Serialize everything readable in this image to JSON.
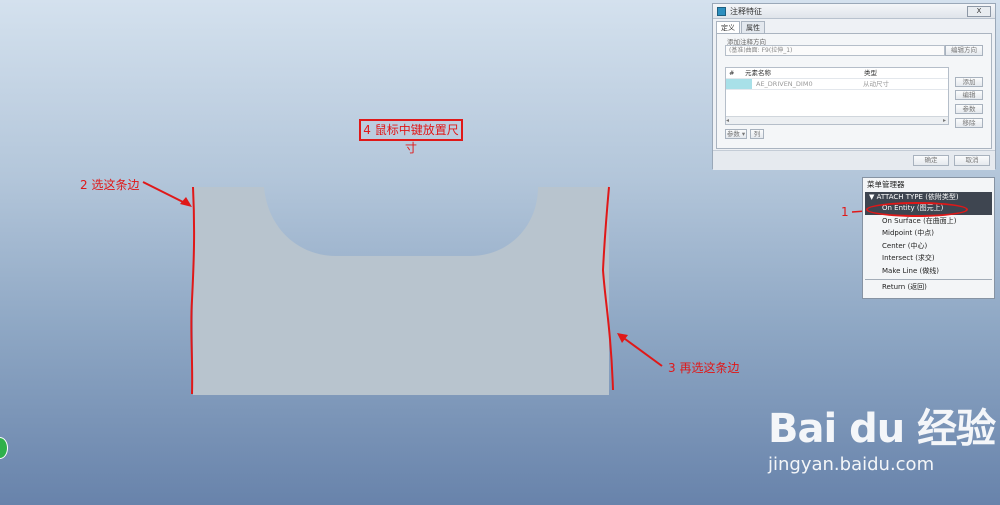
{
  "annotations": {
    "step4": "4 鼠标中键放置尺寸",
    "step2": "2 选这条边",
    "step1": "1",
    "step3": "3 再选这条边"
  },
  "dialog": {
    "title": "注释特征",
    "close_label": "X",
    "tabs": [
      "定义",
      "属性"
    ],
    "direction_group": "添加注释方向",
    "direction_value": "(基准)曲面: F9(拉伸_1)",
    "edit_direction_button": "编辑方向",
    "table_headers": [
      "#",
      "元素名称",
      "类型"
    ],
    "rows": [
      {
        "num": "",
        "name": "AE_DRIVEN_DIM0",
        "type": "从动尺寸"
      }
    ],
    "side_buttons": [
      "添加",
      "编辑",
      "参数",
      "移除"
    ],
    "param_button": "参数 ▾",
    "col_button": "列",
    "ok_button": "确定",
    "cancel_button": "取消"
  },
  "menu": {
    "title": "菜单管理器",
    "header": "ATTACH TYPE (依附类型)",
    "items": [
      "On Entity (图元上)",
      "On Surface (在曲面上)",
      "Midpoint (中点)",
      "Center (中心)",
      "Intersect (求交)",
      "Make Line (做线)"
    ],
    "selected_index": 0,
    "return_item": "Return (返回)"
  },
  "watermark": {
    "logo": "Bai du 经验",
    "url": "jingyan.baidu.com"
  },
  "colors": {
    "annotation": "#e01818",
    "part_fill": "#b8c4ce",
    "highlight_cell": "#a8e0e8",
    "menu_selected": "#3e4550"
  }
}
